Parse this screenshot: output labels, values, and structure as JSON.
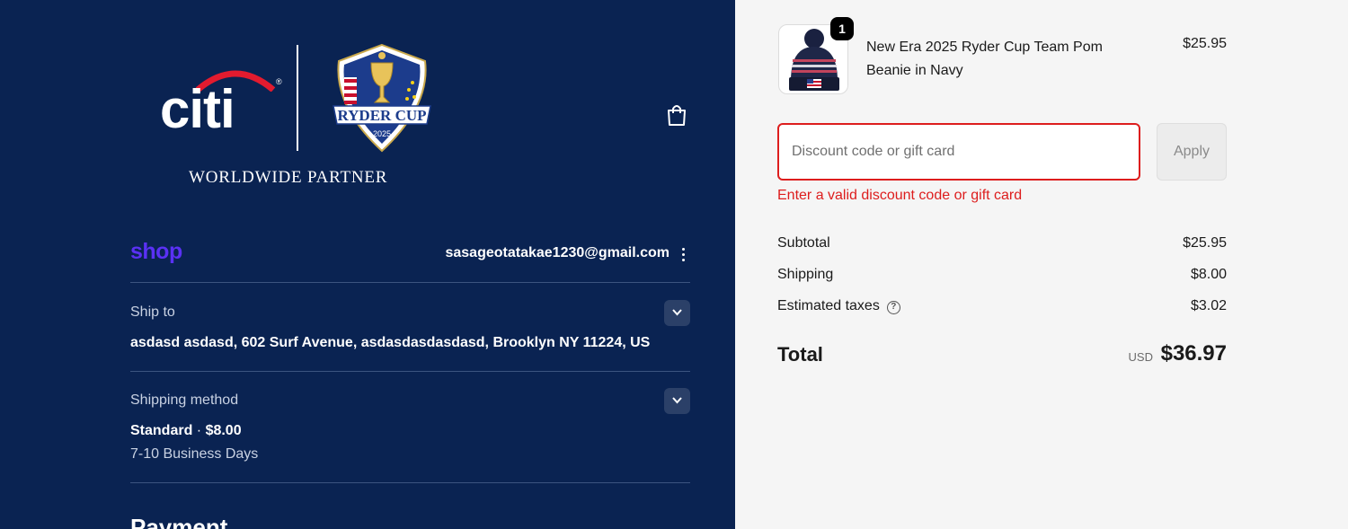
{
  "header": {
    "brand_name": "citi",
    "registered_mark": "®",
    "crest_text": "RYDER CUP",
    "crest_year": "2025",
    "tagline": "WORLDWIDE PARTNER",
    "cart_icon": "shopping-bag-icon"
  },
  "shop": {
    "logo": "shop",
    "email": "sasageotatakae1230@gmail.com",
    "menu_icon": "kebab-menu-icon"
  },
  "ship_to": {
    "label": "Ship to",
    "address": "asdasd asdasd, 602 Surf Avenue, asdasdasdasdasd, Brooklyn NY 11224, US"
  },
  "shipping_method": {
    "label": "Shipping method",
    "name": "Standard",
    "separator": " · ",
    "price": "$8.00",
    "eta": "7-10 Business Days"
  },
  "payment": {
    "heading": "Payment"
  },
  "order": {
    "item": {
      "quantity": "1",
      "name": "New Era 2025 Ryder Cup Team Pom Beanie in Navy",
      "price": "$25.95"
    },
    "discount": {
      "placeholder": "Discount code or gift card",
      "value": "",
      "apply_label": "Apply",
      "error": "Enter a valid discount code or gift card"
    },
    "summary": {
      "subtotal_label": "Subtotal",
      "subtotal": "$25.95",
      "shipping_label": "Shipping",
      "shipping": "$8.00",
      "taxes_label": "Estimated taxes",
      "taxes": "$3.02",
      "total_label": "Total",
      "currency": "USD",
      "total": "$36.97"
    }
  },
  "colors": {
    "left_bg": "#0a2352",
    "shop_purple": "#5a31f4",
    "error_red": "#dd1d1d",
    "citi_arc_red": "#e21b2f"
  }
}
